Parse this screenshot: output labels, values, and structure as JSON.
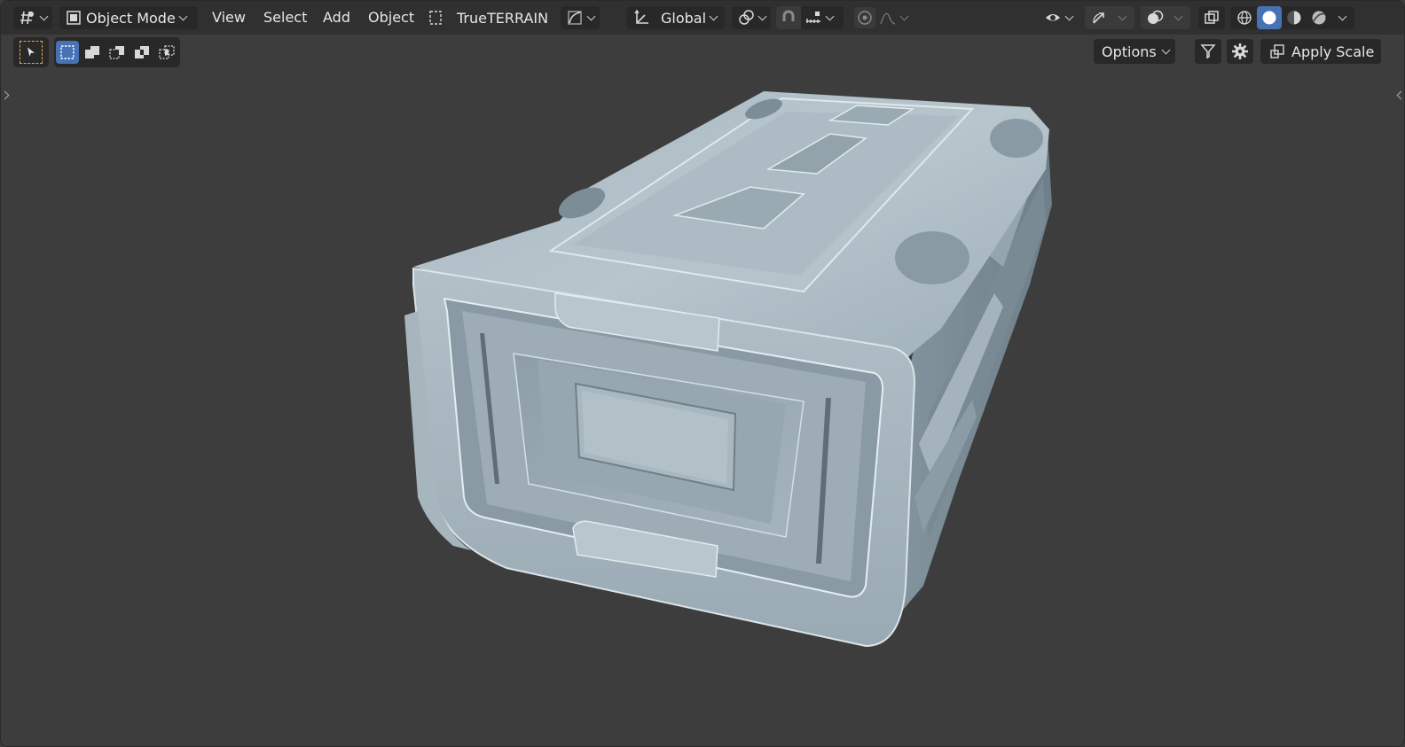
{
  "header": {
    "editor_type_icon": "grid-editor-icon",
    "mode": {
      "label": "Object Mode",
      "icon": "object-mode-icon"
    },
    "menus": [
      "View",
      "Select",
      "Add",
      "Object"
    ],
    "addon": {
      "label": "TrueTERRAIN",
      "icon": "dashed-square-icon"
    },
    "falloff_icon": "curve-falloff-icon",
    "transform_orientation": {
      "label": "Global",
      "icon": "axes-icon"
    },
    "pivot_icon": "pivot-point-icon",
    "snap_icons": [
      "magnet-snap-icon",
      "snap-increment-icon"
    ],
    "proportional_icons": [
      "proportional-edit-icon",
      "proportional-falloff-icon"
    ],
    "right_icons": [
      "visibility-eye-icon",
      "gizmo-icon",
      "overlays-icon",
      "xray-icon"
    ],
    "shading_modes": [
      "wireframe-shading-icon",
      "solid-shading-icon",
      "material-preview-icon",
      "rendered-shading-icon"
    ],
    "active_shading": 1
  },
  "toolbar": {
    "tool_icon": "select-cursor-icon",
    "selection_modes": [
      "select-new-icon",
      "select-extend-icon",
      "select-subtract-icon",
      "select-invert-icon",
      "select-intersect-icon"
    ],
    "active_selection_mode": 0,
    "options_label": "Options",
    "apply_scale_label": "Apply Scale"
  },
  "colors": {
    "accent": "#4772b3",
    "header_bg": "#303030",
    "viewport_bg": "#3d3d3d",
    "mesh_base": "#9fb0ba",
    "mesh_highlight": "#e6eef2",
    "mesh_shadow": "#6c7c86",
    "tool_outline": "#e8a93a"
  }
}
